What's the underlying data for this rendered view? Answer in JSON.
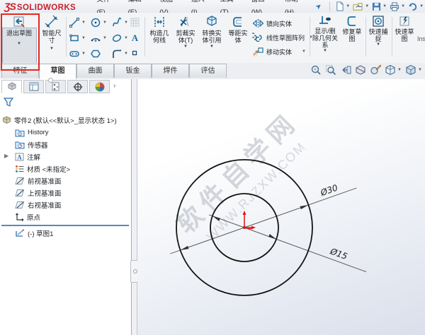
{
  "title_bar": {
    "logo_mark": "ƷS",
    "logo_text": "SOLIDWORKS",
    "menus": [
      "文件(F)",
      "编辑(E)",
      "视图(V)",
      "插入(I)",
      "工具(T)",
      "窗口(W)",
      "帮助(H)"
    ]
  },
  "ribbon": {
    "exit_sketch": "退出草图",
    "smart_dimension": "智能尺寸",
    "construction": "构造几何线",
    "trim": "剪裁实体(T)",
    "convert": "转换实体引用",
    "offset": "等距实体",
    "mirror": "镜向实体",
    "linear_pattern": "线性草图阵列",
    "move": "移动实体",
    "display_relations": "显示/删除几何关系",
    "repair": "修复草图",
    "quick_snaps": "快速捕捉",
    "rapid_sketch": "快速草图",
    "truncated": "Ins"
  },
  "tabs": [
    "特征",
    "草图",
    "曲面",
    "钣金",
    "焊件",
    "评估"
  ],
  "active_tab": "草图",
  "feature_tree": {
    "root": "零件2 (默认<<默认>_显示状态 1>)",
    "items": [
      "History",
      "传感器",
      "注解",
      "材质 <未指定>",
      "前视基准面",
      "上视基准面",
      "右视基准面",
      "原点",
      "(-) 草图1"
    ]
  },
  "drawing": {
    "dim_outer": "Ø30",
    "dim_inner": "Ø15",
    "watermark_line1": "软件自学网",
    "watermark_line2": "WWW.RJZXW.COM"
  },
  "colors": {
    "annotation_red": "#e8271d",
    "icon_blue": "#1e6fa4",
    "origin_red": "#e01010"
  }
}
